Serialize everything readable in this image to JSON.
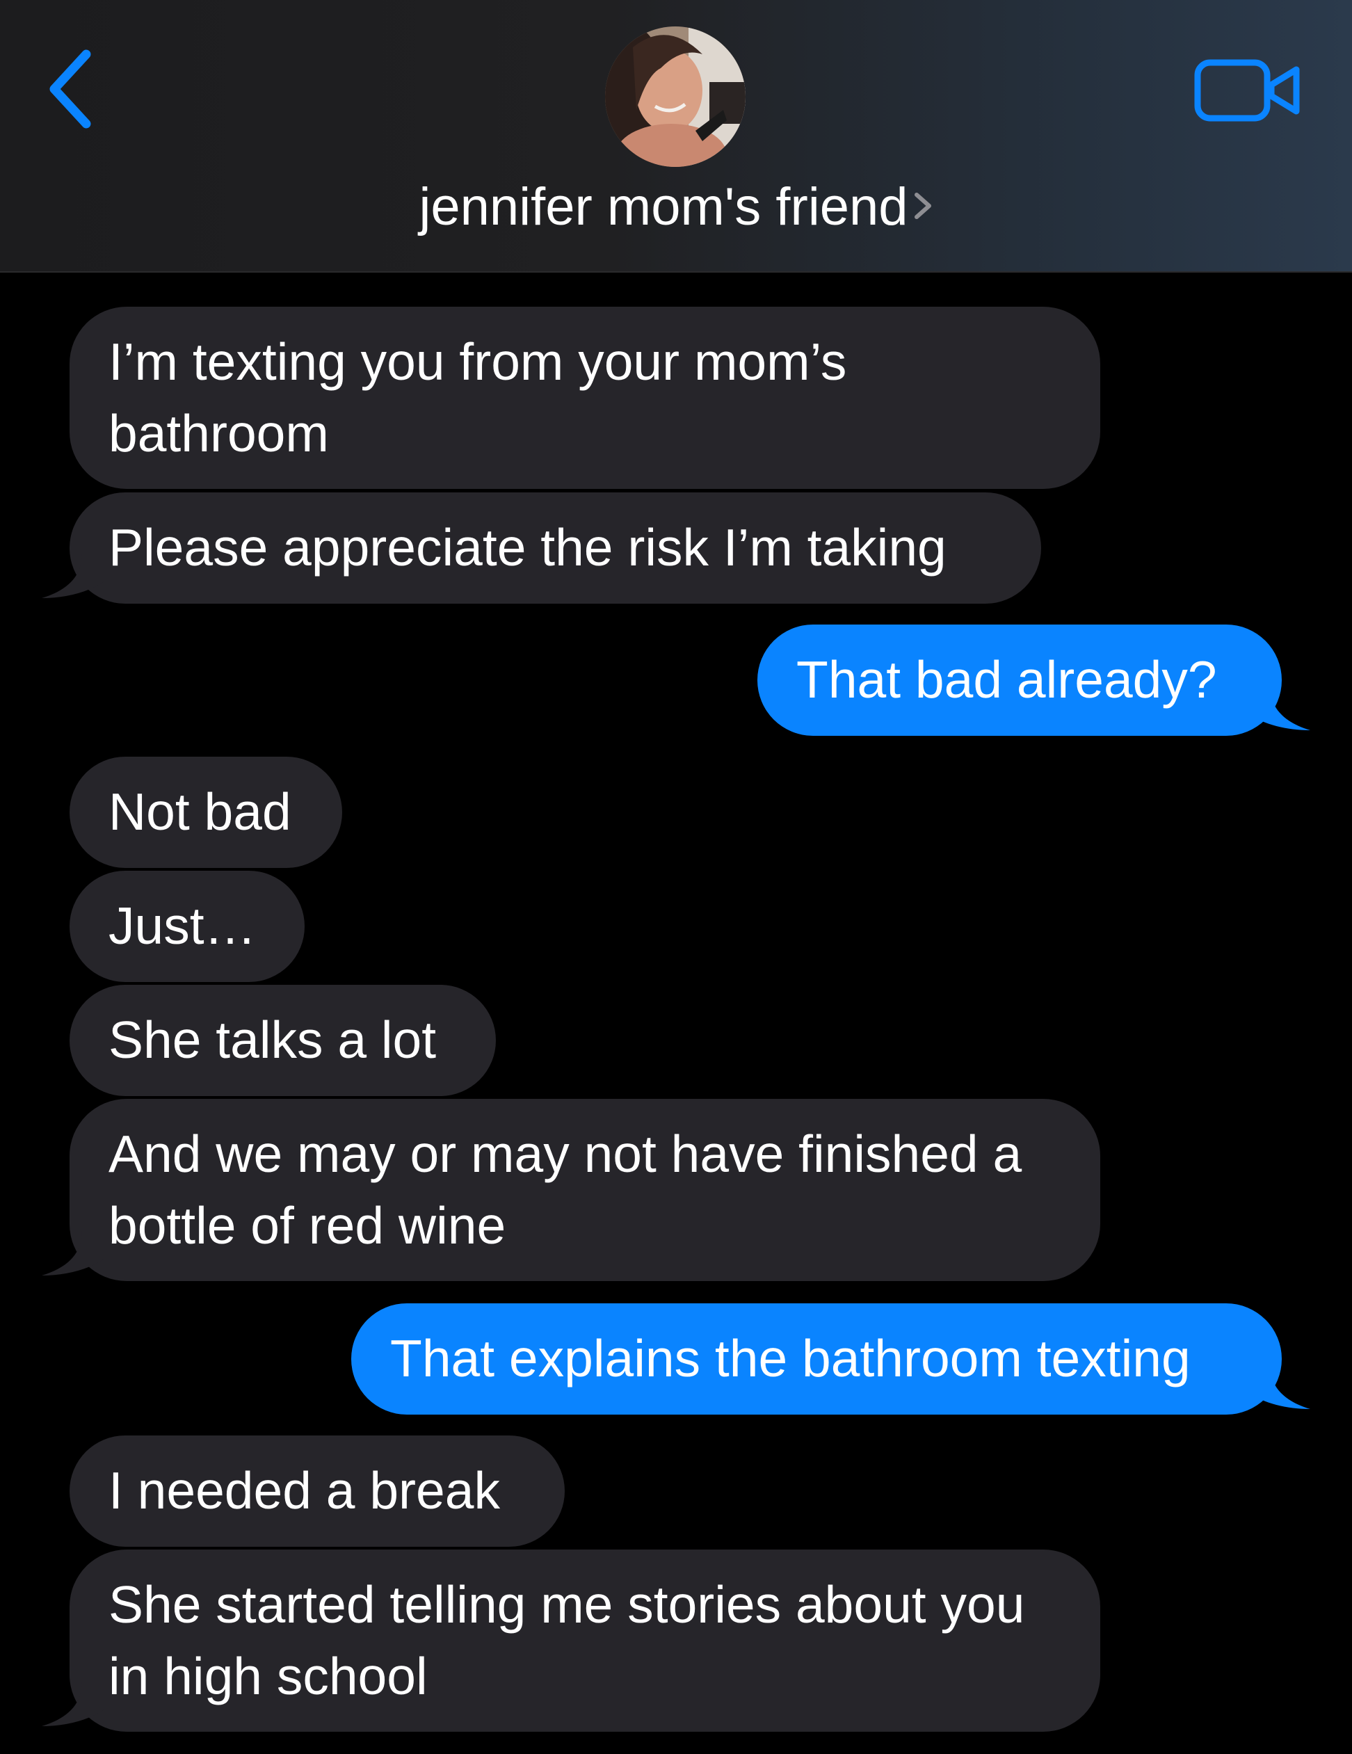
{
  "header": {
    "contact_name": "jennifer mom's friend",
    "back_icon": "chevron-left-icon",
    "video_icon": "video-camera-icon",
    "accent_color": "#0a84ff"
  },
  "messages": [
    {
      "sender": "them",
      "text": "I’m texting you from your mom’s bathroom"
    },
    {
      "sender": "them",
      "text": "Please appreciate the risk I’m taking"
    },
    {
      "sender": "me",
      "text": "That bad already?"
    },
    {
      "sender": "them",
      "text": "Not bad"
    },
    {
      "sender": "them",
      "text": "Just…"
    },
    {
      "sender": "them",
      "text": "She talks a lot"
    },
    {
      "sender": "them",
      "text": "And we may or may not have finished a bottle of red wine"
    },
    {
      "sender": "me",
      "text": "That explains the bathroom texting"
    },
    {
      "sender": "them",
      "text": "I needed a break"
    },
    {
      "sender": "them",
      "text": "She started telling me stories about you in high school"
    }
  ],
  "colors": {
    "incoming_bubble": "#26252a",
    "outgoing_bubble": "#0a84ff",
    "background": "#000000"
  }
}
